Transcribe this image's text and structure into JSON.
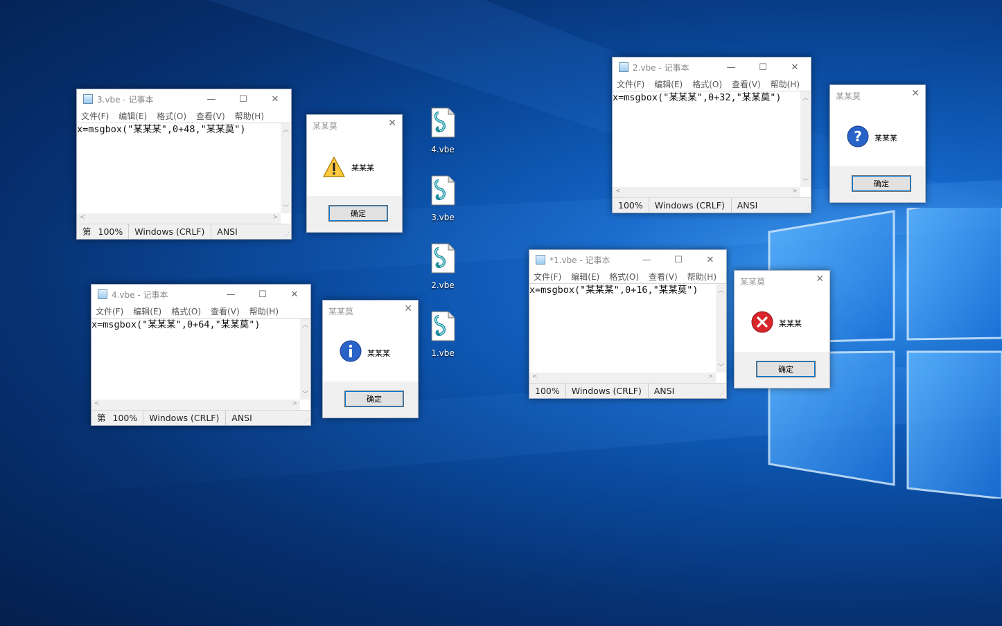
{
  "notepads": [
    {
      "id": "np3",
      "title": "3.vbe - 记事本",
      "menu": [
        "文件(F)",
        "编辑(E)",
        "格式(O)",
        "查看(V)",
        "帮助(H)"
      ],
      "content": "x=msgbox(\"某某某\",0+48,\"某某莫\")",
      "status": {
        "prefix": "第",
        "zoom": "100%",
        "eol": "Windows (CRLF)",
        "encoding": "ANSI"
      }
    },
    {
      "id": "np4",
      "title": "4.vbe - 记事本",
      "menu": [
        "文件(F)",
        "编辑(E)",
        "格式(O)",
        "查看(V)",
        "帮助(H)"
      ],
      "content": "x=msgbox(\"某某某\",0+64,\"某某莫\")",
      "status": {
        "prefix": "第",
        "zoom": "100%",
        "eol": "Windows (CRLF)",
        "encoding": "ANSI"
      }
    },
    {
      "id": "np2",
      "title": "2.vbe - 记事本",
      "menu": [
        "文件(F)",
        "编辑(E)",
        "格式(O)",
        "查看(V)",
        "帮助(H)"
      ],
      "content": "x=msgbox(\"某某某\",0+32,\"某某莫\")",
      "status": {
        "prefix": "",
        "zoom": "100%",
        "eol": "Windows (CRLF)",
        "encoding": "ANSI"
      }
    },
    {
      "id": "np1",
      "title": "*1.vbe - 记事本",
      "menu": [
        "文件(F)",
        "编辑(E)",
        "格式(O)",
        "查看(V)",
        "帮助(H)"
      ],
      "content": "x=msgbox(\"某某某\",0+16,\"某某莫\")",
      "status": {
        "prefix": "",
        "zoom": "100%",
        "eol": "Windows (CRLF)",
        "encoding": "ANSI"
      }
    }
  ],
  "msgboxes": [
    {
      "id": "mb-warning",
      "title": "某某莫",
      "message": "某某某",
      "ok": "确定",
      "icon": "warning-icon"
    },
    {
      "id": "mb-info",
      "title": "某某莫",
      "message": "某某某",
      "ok": "确定",
      "icon": "info-icon"
    },
    {
      "id": "mb-question",
      "title": "某某莫",
      "message": "某某某",
      "ok": "确定",
      "icon": "question-icon"
    },
    {
      "id": "mb-error",
      "title": "某某莫",
      "message": "某某某",
      "ok": "确定",
      "icon": "error-icon"
    }
  ],
  "desktop_icons": [
    "4.vbe",
    "3.vbe",
    "2.vbe",
    "1.vbe"
  ],
  "colors": {
    "desktop": "#0a4a9e",
    "accent": "#0078d7"
  }
}
